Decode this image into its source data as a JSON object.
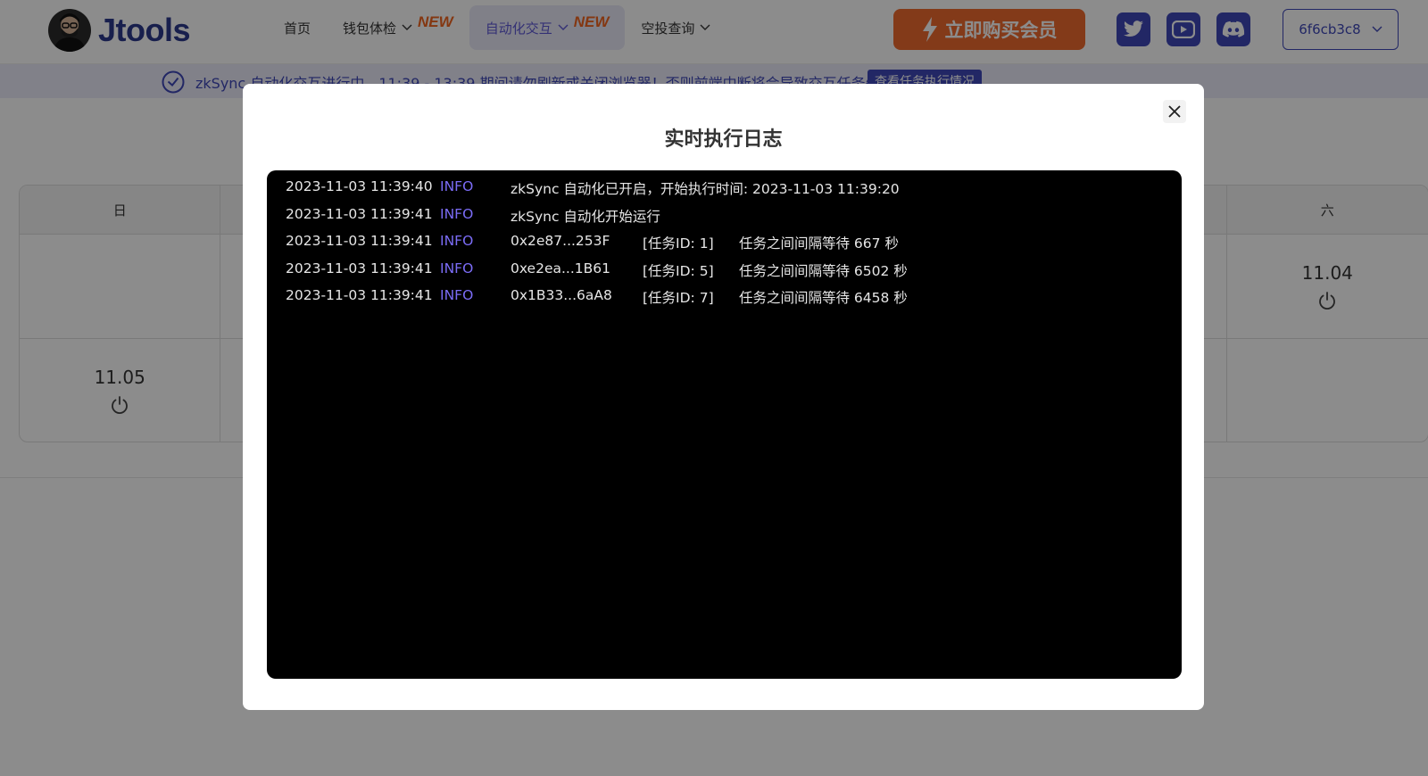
{
  "header": {
    "logo_text": "Jtools",
    "nav": [
      {
        "label": "首页",
        "has_dropdown": false,
        "new": ""
      },
      {
        "label": "钱包体检",
        "has_dropdown": true,
        "new": "NEW"
      },
      {
        "label": "自动化交互",
        "has_dropdown": true,
        "new": "NEW",
        "active": true
      },
      {
        "label": "空投查询",
        "has_dropdown": true,
        "new": ""
      }
    ],
    "buy_button": "立即购买会员",
    "social_icons": [
      "twitter-icon",
      "youtube-icon",
      "discord-icon"
    ],
    "wallet_label": "6f6cb3c8"
  },
  "notice": {
    "text": "zkSync 自动化交互进行中，11:39 - 13:39 期间请勿刷新或关闭浏览器！否则前端中断将会导致交互任务失败！",
    "link": "查看任务执行情况"
  },
  "calendar": {
    "weekdays": [
      "日",
      "",
      "",
      "",
      "",
      "",
      "六"
    ],
    "rows": [
      [
        "",
        "",
        "",
        "",
        "",
        "",
        "11.04"
      ],
      [
        "11.05",
        "",
        "",
        "",
        "",
        "",
        ""
      ]
    ]
  },
  "modal": {
    "title": "实时执行日志",
    "logs": [
      {
        "ts": "2023-11-03 11:39:40",
        "level": "INFO",
        "msg": "zkSync 自动化已开启，开始执行时间: 2023-11-03 11:39:20"
      },
      {
        "ts": "2023-11-03 11:39:41",
        "level": "INFO",
        "msg": "zkSync 自动化开始运行"
      },
      {
        "ts": "2023-11-03 11:39:41",
        "level": "INFO",
        "addr": "0x2e87...253F",
        "task": "[任务ID: 1]",
        "task_msg": "任务之间间隔等待 667 秒"
      },
      {
        "ts": "2023-11-03 11:39:41",
        "level": "INFO",
        "addr": "0xe2ea...1B61",
        "task": "[任务ID: 5]",
        "task_msg": "任务之间间隔等待 6502 秒"
      },
      {
        "ts": "2023-11-03 11:39:41",
        "level": "INFO",
        "addr": "0x1B33...6aA8",
        "task": "[任务ID: 7]",
        "task_msg": "任务之间间隔等待 6458 秒"
      }
    ]
  },
  "colors": {
    "brand": "#3f48b8",
    "accent_orange": "#ee6a2e",
    "log_level": "#7b6cf6",
    "active_nav_bg": "#e9e9f8"
  }
}
